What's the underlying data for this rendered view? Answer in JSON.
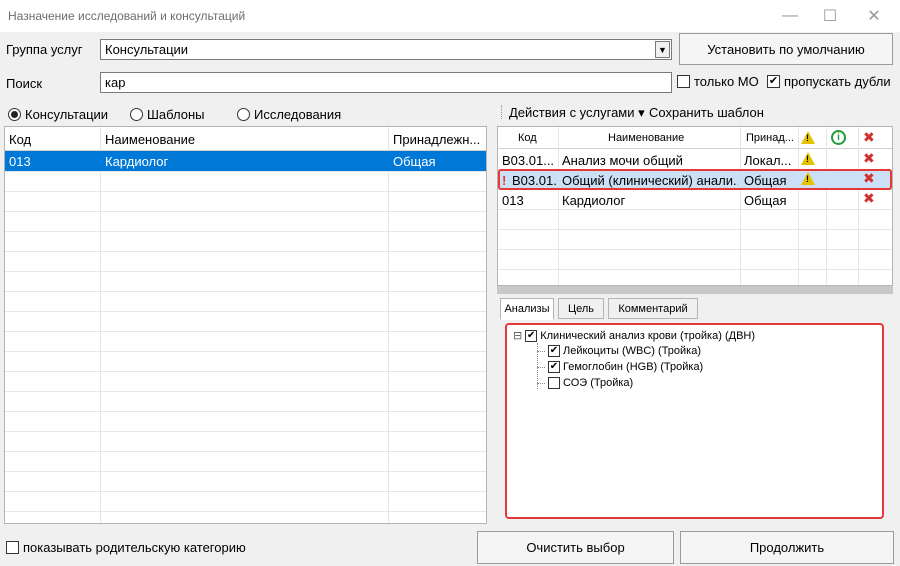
{
  "window": {
    "title": "Назначение исследований и консультаций",
    "minimize": "—",
    "maximize": "☐",
    "close": "✕"
  },
  "form": {
    "group_label": "Группа услуг",
    "group_value": "Консультации",
    "default_button": "Установить по умолчанию",
    "search_label": "Поиск",
    "search_value": "кар",
    "only_mo_label": "только МО",
    "only_mo_checked": false,
    "skip_dupes_label": "пропускать дубли",
    "skip_dupes_checked": true
  },
  "filter": {
    "options": [
      "Консультации",
      "Шаблоны",
      "Исследования"
    ],
    "selected": "Консультации"
  },
  "left_table": {
    "columns": [
      "Код",
      "Наименование",
      "Принадлежн..."
    ],
    "rows": [
      {
        "code": "013",
        "name": "Кардиолог",
        "owner": "Общая",
        "selected": true
      }
    ]
  },
  "right_toolbar": {
    "actions_label": "Действия с услугами",
    "save_template_label": "Сохранить шаблон"
  },
  "right_table": {
    "columns": [
      "Код",
      "Наименование",
      "Принад..."
    ],
    "rows": [
      {
        "code": "B03.01...",
        "name": "Анализ мочи общий",
        "owner": "Локал...",
        "warn": true,
        "marker": ""
      },
      {
        "code": "B03.01.",
        "name": "Общий (клинический) анали...",
        "owner": "Общая",
        "warn": true,
        "marker": "!"
      },
      {
        "code": "013",
        "name": "Кардиолог",
        "owner": "Общая",
        "warn": false,
        "marker": ""
      }
    ]
  },
  "tabs": [
    "Анализы",
    "Цель",
    "Комментарий"
  ],
  "tree": {
    "root": {
      "label": "Клинический анализ крови (тройка) (ДВН)",
      "checked": true,
      "expander": "⊟"
    },
    "children": [
      {
        "label": "Лейкоциты (WBC) (Тройка)",
        "checked": true
      },
      {
        "label": "Гемоглобин (HGB) (Тройка)",
        "checked": true
      },
      {
        "label": "СОЭ (Тройка)",
        "checked": false
      }
    ]
  },
  "footer": {
    "show_parent_label": "показывать родительскую категорию",
    "show_parent_checked": false,
    "clear_button": "Очистить выбор",
    "continue_button": "Продолжить"
  },
  "icons": {
    "checkmark": "✔",
    "dropdown": "▼",
    "info": "i",
    "delete": "✖",
    "menu_caret": "▾"
  },
  "colors": {
    "selection": "#0078d7",
    "row_highlight": "#cce0f5",
    "alert_red": "#e53935",
    "warning_yellow": "#e6c300",
    "info_green": "#1e9e3a"
  }
}
